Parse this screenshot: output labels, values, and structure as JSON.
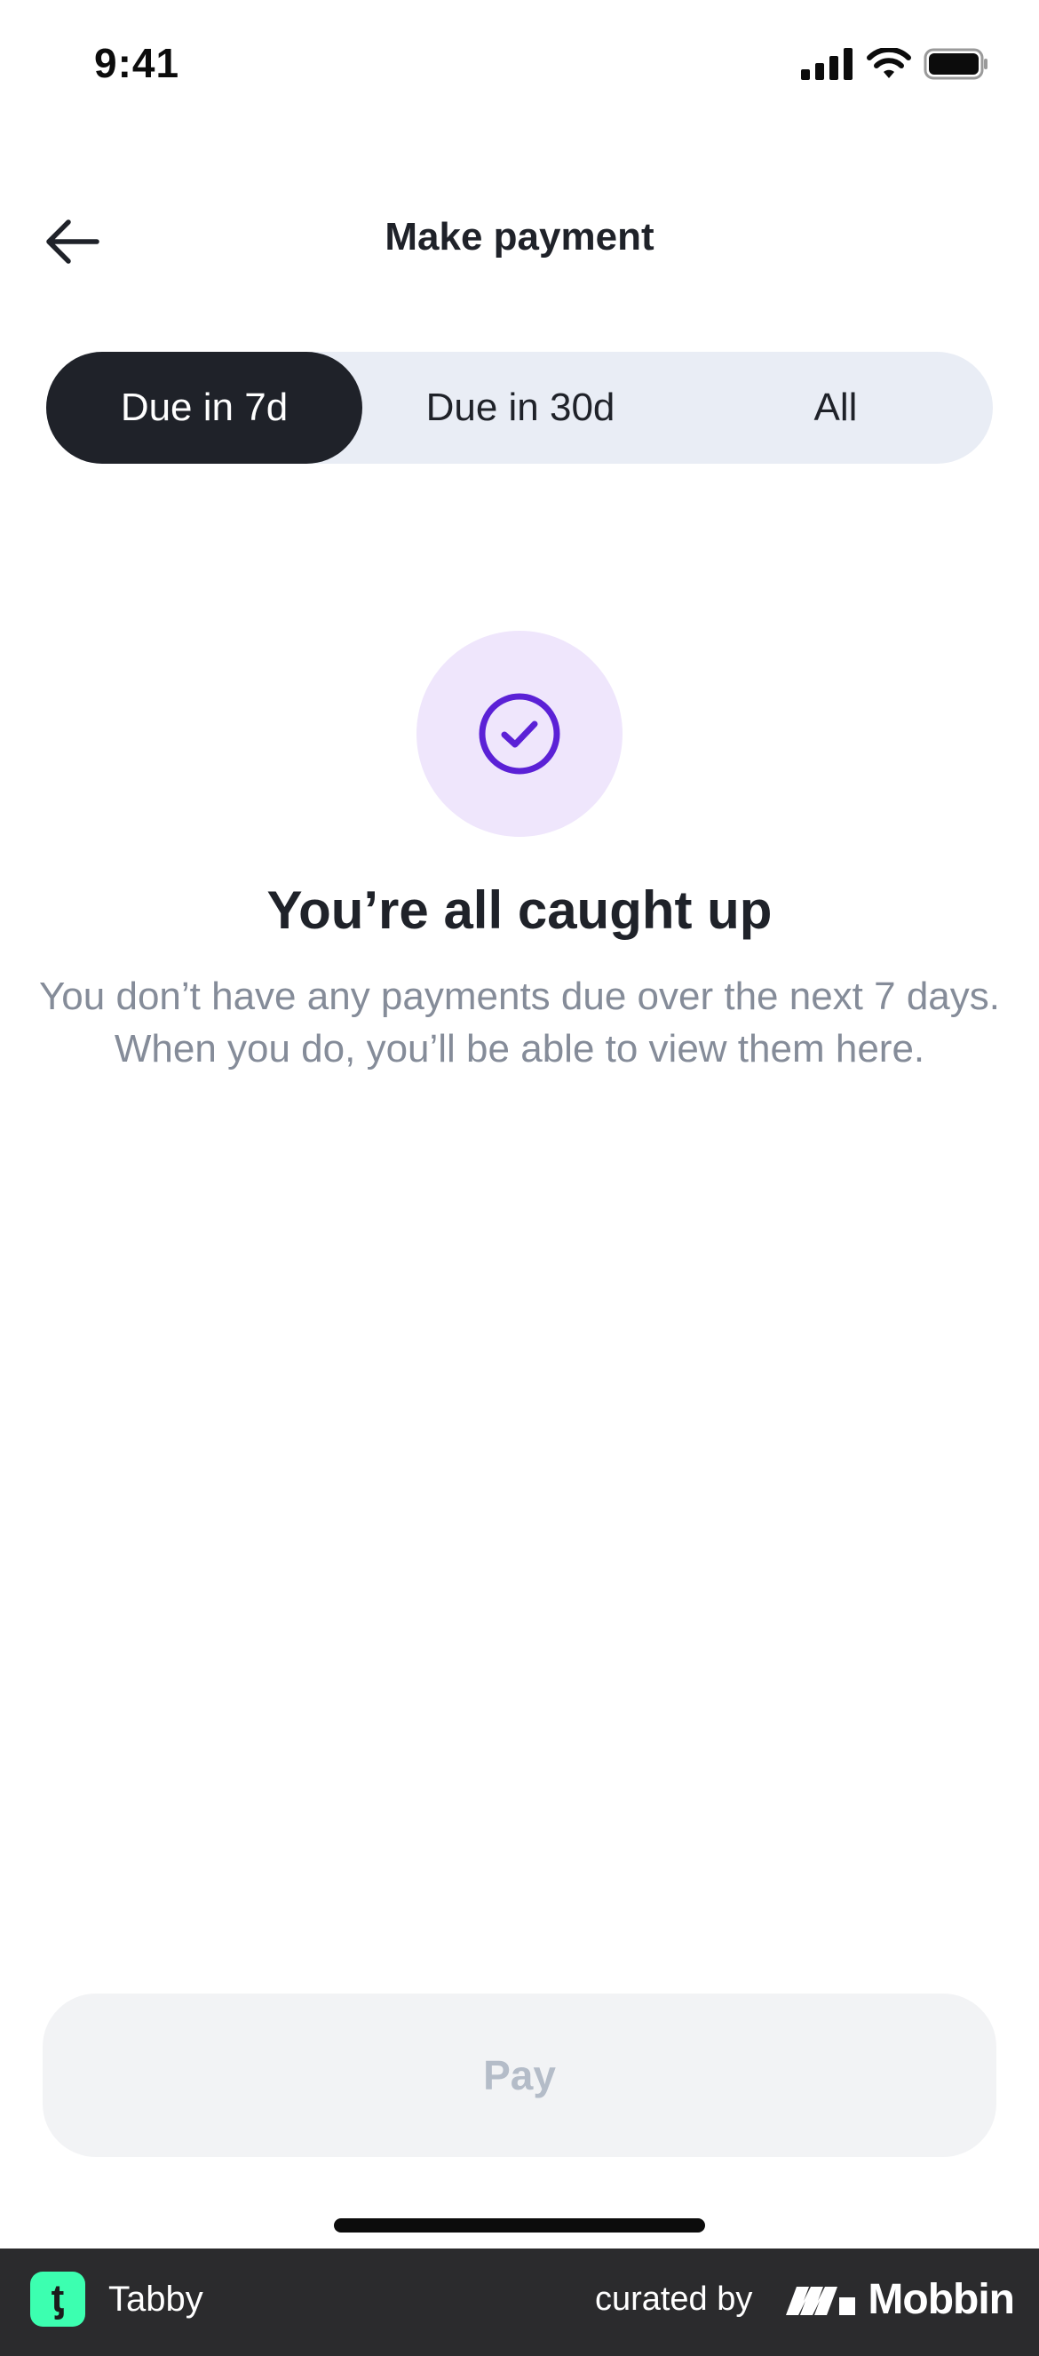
{
  "status_bar": {
    "time": "9:41",
    "icons": [
      "cellular-signal-icon",
      "wifi-icon",
      "battery-icon"
    ]
  },
  "header": {
    "title": "Make payment",
    "back_icon": "arrow-left-icon"
  },
  "tabs": [
    {
      "label": "Due in 7d",
      "active": true
    },
    {
      "label": "Due in 30d",
      "active": false
    },
    {
      "label": "All",
      "active": false
    }
  ],
  "empty_state": {
    "icon": "check-circle-icon",
    "title": "You’re all caught up",
    "body": "You don’t have any payments due over the next 7 days. When you do, you’ll be able to view them here."
  },
  "pay_button": {
    "label": "Pay",
    "enabled": false
  },
  "footer": {
    "app_name": "Tabby",
    "app_logo_glyph": "ƫ",
    "curated_by": "curated by",
    "brand": "Mobbin"
  },
  "colors": {
    "tab_active_bg": "#1f2229",
    "tab_track_bg": "#e9edf5",
    "icon_accent": "#5b21d6",
    "icon_circle_bg": "#efe6fc",
    "body_text": "#858c99",
    "pay_disabled_bg": "#f2f3f5",
    "pay_disabled_text": "#b4bcc8",
    "footer_bg": "#2b2b2d",
    "tabby_logo_bg": "#3cffb0"
  }
}
